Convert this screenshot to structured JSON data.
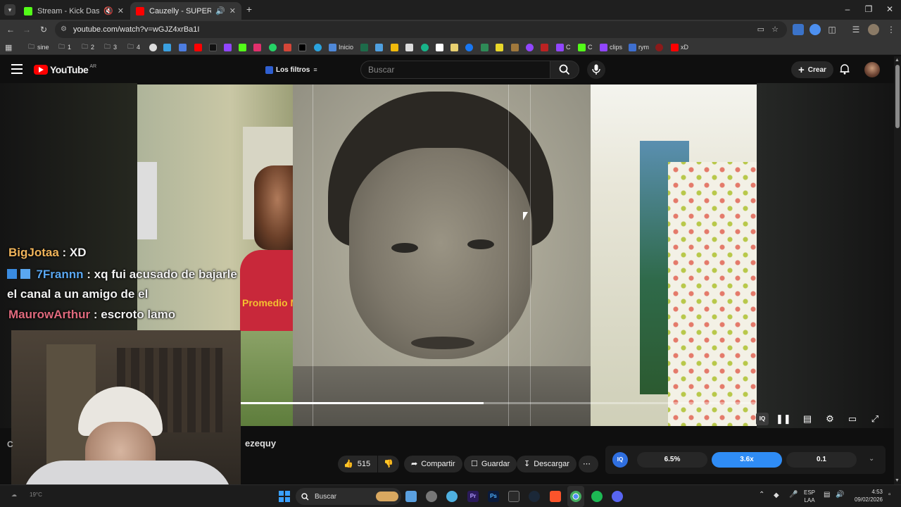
{
  "browser": {
    "tabs": [
      {
        "title": "Stream - Kick Dashboard",
        "active": false
      },
      {
        "title": "Cauzelly - SUPERCAUSA (Y",
        "active": true
      }
    ],
    "url": "youtube.com/watch?v=wGJZ4xrBa1I",
    "bookmarks": [
      "sine",
      "1",
      "2",
      "3",
      "4",
      "Inicio",
      "C",
      "C",
      "clips",
      "rym",
      "xD"
    ]
  },
  "youtube": {
    "logo_text": "YouTube",
    "region": "AR",
    "filter_label": "Los filtros",
    "search_placeholder": "Buscar",
    "create_label": "Crear",
    "channel_partial": "C",
    "uploader_partial": "ezequy",
    "likes": "515",
    "share_label": "Compartir",
    "save_label": "Guardar",
    "download_label": "Descargar"
  },
  "video_overlay": {
    "caption": "Promedio M"
  },
  "chat": [
    {
      "user": "BigJotaa",
      "message": ": XD",
      "color": "#f0b45a"
    },
    {
      "user": "7Frannn",
      "message": ": xq fui acusado de bajarle",
      "continuation": "el canal a un amigo de el",
      "color": "#5aa7f0"
    },
    {
      "user": "MaurowArthur",
      "message": ": escroto lamo",
      "color": "#e06a7d"
    }
  ],
  "extension_bar": {
    "values": [
      "6.5%",
      "3.6x",
      "0.1"
    ],
    "active_index": 1,
    "accent": "#2f8cf5"
  },
  "taskbar": {
    "weather": "19°C",
    "search_label": "Buscar",
    "lang_top": "ESP",
    "lang_bottom": "LAA",
    "time": "4:53",
    "date": "09/02/2026"
  },
  "colors": {
    "youtube_red": "#ff0000",
    "kick_green": "#53fc18",
    "progress": "#ffffff"
  },
  "progress": 0.47
}
